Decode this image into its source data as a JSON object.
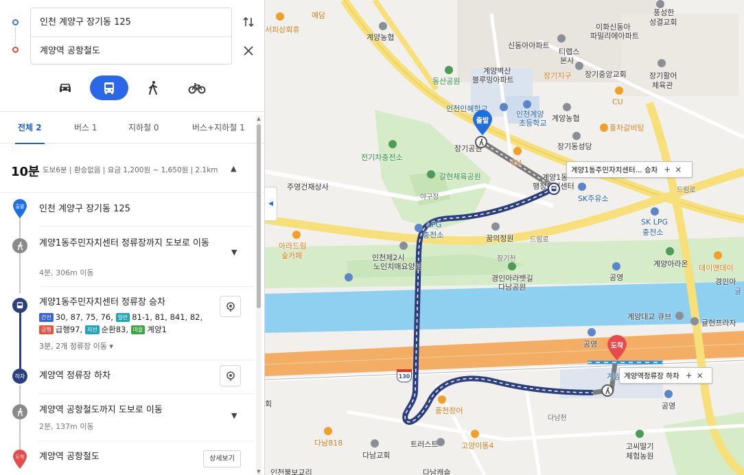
{
  "colors": {
    "accent": "#2b68e8",
    "route_navy": "#2b3f80",
    "start_pin": "#1f6fe0",
    "end_pin": "#e84b4b",
    "river": "#8fd0f0",
    "highway": "#f4ad64"
  },
  "search": {
    "origin": "인천 계양구 장기동 125",
    "destination": "계양역 공항철도",
    "swap_icon": "swap-vertical-icon",
    "close_icon": "close-icon"
  },
  "modes": [
    {
      "name": "car",
      "icon": "car-icon",
      "active": false
    },
    {
      "name": "transit",
      "icon": "bus-icon",
      "active": true
    },
    {
      "name": "walk",
      "icon": "walk-icon",
      "active": false
    },
    {
      "name": "bike",
      "icon": "bike-icon",
      "active": false
    }
  ],
  "tabs": [
    {
      "label": "전체 2",
      "active": true
    },
    {
      "label": "버스 1",
      "active": false
    },
    {
      "label": "지하철 0",
      "active": false
    },
    {
      "label": "버스+지하철 1",
      "active": false
    }
  ],
  "summary": {
    "time": "10분",
    "detail": "도보6분 | 환승없음 | 요금 1,200원 ~ 1,650원 | 2.1km"
  },
  "steps": {
    "start_badge": "출발",
    "start_label": "인천 계양구 장기동 125",
    "walk1_label": "계양1동주민자치센터 정류장까지 도보로 이동",
    "walk1_sub": "4분, 306m 이동",
    "board_label": "계양1동주민자치센터 정류장 승차",
    "bus_row1": {
      "tag": "간선",
      "lines": "30,  87,  75,  76,",
      "tag2": "일반",
      "lines2": "81-1,  81,  841,  82,"
    },
    "bus_row2": {
      "tag": "급행",
      "lines": "급행97,",
      "tag2": "지선",
      "lines2": "순환83,",
      "tag3": "마을",
      "lines3": "계양1"
    },
    "stops_info": "3분, 2개 정류장 이동 ▾",
    "alight_badge": "하차",
    "alight_label": "계양역 정류장 하차",
    "walk2_label": "계양역 공항철도까지 도보로 이동",
    "walk2_sub": "2분, 137m 이동",
    "end_badge": "도착",
    "end_label": "계양역 공항철도",
    "detail_button": "상세보기"
  },
  "map": {
    "start_pin_label": "출발",
    "end_pin_label": "도착",
    "callout_board": {
      "label": "계양1동주민자치센터...  승차"
    },
    "callout_alight": {
      "label": "계양역정류장 하차"
    },
    "highway_number": "130",
    "labels": [
      "예담",
      "서피상회휴",
      "계양농협",
      "풍성한",
      "성결교회",
      "이화신동아",
      "파밀리에아파트",
      "신동아아파트",
      "티렙스",
      "본사",
      "계양벽산",
      "블루밍아파트",
      "동산공원",
      "장기지구",
      "장기중앙교회",
      "장기활어",
      "체육관",
      "CU",
      "인천인혜학교",
      "인천계양",
      "초등학교",
      "계양농협",
      "풍차갈비탕",
      "장기공원",
      "장기동성당",
      "전기차충전소",
      "CU",
      "계양1동",
      "행정복지센터",
      "드림로",
      "갈현체육공원",
      "주영건재상사",
      "야구장",
      "SK주유소",
      "SK LPG",
      "충전소",
      "LPG",
      "충전소",
      "꿈의정원",
      "드림로",
      "아라드림",
      "숲카페",
      "인천제2시",
      "노인치매요양원",
      "장기천",
      "계양아라온",
      "데이앤데이",
      "경인아라뱃길",
      "다남공원",
      "공영",
      "경인아",
      "글",
      "계양대교 큐브",
      "귤현프라자",
      "공영",
      "계양",
      "공영",
      "풍천장어",
      "회",
      "다남818",
      "트러스트",
      "고양이똥4",
      "다남교회",
      "고씨딸기",
      "체험농원",
      "인천불보교리",
      "다남캐슬",
      "다남천"
    ]
  }
}
